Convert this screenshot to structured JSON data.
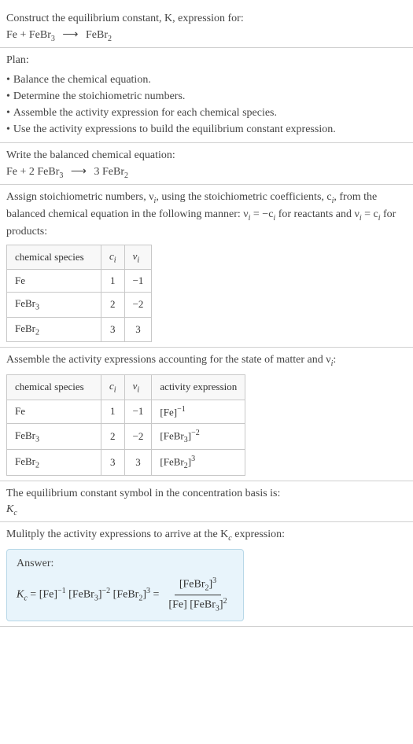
{
  "header": {
    "line1": "Construct the equilibrium constant, K, expression for:",
    "equation_lhs": "Fe + FeBr",
    "equation_sub1": "3",
    "equation_arrow": "⟶",
    "equation_rhs": "FeBr",
    "equation_sub2": "2"
  },
  "plan": {
    "title": "Plan:",
    "items": [
      "Balance the chemical equation.",
      "Determine the stoichiometric numbers.",
      "Assemble the activity expression for each chemical species.",
      "Use the activity expressions to build the equilibrium constant expression."
    ]
  },
  "balanced": {
    "title": "Write the balanced chemical equation:",
    "lhs1": "Fe + 2 FeBr",
    "sub1": "3",
    "arrow": "⟶",
    "rhs": "3 FeBr",
    "sub2": "2"
  },
  "assign": {
    "line1_a": "Assign stoichiometric numbers, ν",
    "line1_sub": "i",
    "line1_b": ", using the stoichiometric coefficients, c",
    "line1_sub2": "i",
    "line1_c": ", from the balanced chemical equation in the following manner: ν",
    "line1_sub3": "i",
    "line1_d": " = −c",
    "line1_sub4": "i",
    "line1_e": " for reactants and ν",
    "line1_sub5": "i",
    "line1_f": " = c",
    "line1_sub6": "i",
    "line1_g": " for products:",
    "table": {
      "h1": "chemical species",
      "h2": "c",
      "h2sub": "i",
      "h3": "ν",
      "h3sub": "i",
      "rows": [
        {
          "species": "Fe",
          "species_sub": "",
          "c": "1",
          "v": "−1"
        },
        {
          "species": "FeBr",
          "species_sub": "3",
          "c": "2",
          "v": "−2"
        },
        {
          "species": "FeBr",
          "species_sub": "2",
          "c": "3",
          "v": "3"
        }
      ]
    }
  },
  "assemble": {
    "title_a": "Assemble the activity expressions accounting for the state of matter and ν",
    "title_sub": "i",
    "title_b": ":",
    "table": {
      "h1": "chemical species",
      "h2": "c",
      "h2sub": "i",
      "h3": "ν",
      "h3sub": "i",
      "h4": "activity expression",
      "rows": [
        {
          "species": "Fe",
          "species_sub": "",
          "c": "1",
          "v": "−1",
          "act_base": "[Fe]",
          "act_sub": "",
          "act_exp": "−1"
        },
        {
          "species": "FeBr",
          "species_sub": "3",
          "c": "2",
          "v": "−2",
          "act_base": "[FeBr",
          "act_sub": "3",
          "act_close": "]",
          "act_exp": "−2"
        },
        {
          "species": "FeBr",
          "species_sub": "2",
          "c": "3",
          "v": "3",
          "act_base": "[FeBr",
          "act_sub": "2",
          "act_close": "]",
          "act_exp": "3"
        }
      ]
    }
  },
  "symbol": {
    "line": "The equilibrium constant symbol in the concentration basis is:",
    "k": "K",
    "ksub": "c"
  },
  "multiply": {
    "line_a": "Mulitply the activity expressions to arrive at the K",
    "line_sub": "c",
    "line_b": " expression:"
  },
  "answer": {
    "label": "Answer:",
    "k": "K",
    "ksub": "c",
    "eq": " = [Fe]",
    "exp1": "−1",
    "t2": " [FeBr",
    "t2sub": "3",
    "t2close": "]",
    "exp2": "−2",
    "t3": " [FeBr",
    "t3sub": "2",
    "t3close": "]",
    "exp3": "3",
    "eq2": " = ",
    "num_a": "[FeBr",
    "num_sub": "2",
    "num_close": "]",
    "num_exp": "3",
    "den_a": "[Fe] [FeBr",
    "den_sub": "3",
    "den_close": "]",
    "den_exp": "2"
  }
}
